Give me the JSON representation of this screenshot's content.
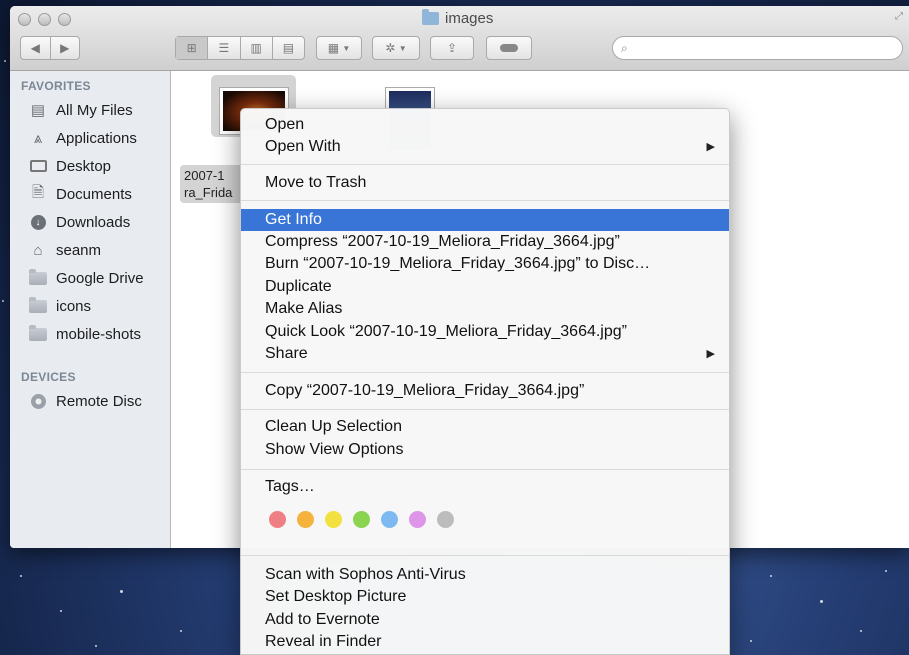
{
  "window": {
    "title": "images"
  },
  "search": {
    "placeholder": ""
  },
  "sidebar": {
    "favorites_header": "FAVORITES",
    "favorites": [
      {
        "label": "All My Files",
        "icon": "all-files-icon"
      },
      {
        "label": "Applications",
        "icon": "applications-icon"
      },
      {
        "label": "Desktop",
        "icon": "desktop-icon"
      },
      {
        "label": "Documents",
        "icon": "documents-icon"
      },
      {
        "label": "Downloads",
        "icon": "downloads-icon"
      },
      {
        "label": "seanm",
        "icon": "home-icon"
      },
      {
        "label": "Google Drive",
        "icon": "folder-icon"
      },
      {
        "label": "icons",
        "icon": "folder-icon"
      },
      {
        "label": "mobile-shots",
        "icon": "folder-icon"
      }
    ],
    "devices_header": "DEVICES",
    "devices": [
      {
        "label": "Remote Disc",
        "icon": "disc-icon"
      }
    ]
  },
  "files": {
    "selected_name_line1": "2007-1",
    "selected_name_line2": "ra_Frida"
  },
  "menu": {
    "open": "Open",
    "open_with": "Open With",
    "move_to_trash": "Move to Trash",
    "get_info": "Get Info",
    "compress": "Compress “2007-10-19_Meliora_Friday_3664.jpg”",
    "burn": "Burn “2007-10-19_Meliora_Friday_3664.jpg” to Disc…",
    "duplicate": "Duplicate",
    "make_alias": "Make Alias",
    "quick_look": "Quick Look “2007-10-19_Meliora_Friday_3664.jpg”",
    "share": "Share",
    "copy": "Copy “2007-10-19_Meliora_Friday_3664.jpg”",
    "clean_up": "Clean Up Selection",
    "show_view_options": "Show View Options",
    "tags": "Tags…",
    "scan_sophos": "Scan with Sophos Anti-Virus",
    "set_desktop": "Set Desktop Picture",
    "add_evernote": "Add to Evernote",
    "reveal_finder": "Reveal in Finder",
    "submenu_arrow": "▶"
  },
  "tag_colors": [
    "#f07f84",
    "#f5b33e",
    "#f3e13f",
    "#8ad451",
    "#7fb9f2",
    "#de95ea",
    "#bcbcbc"
  ],
  "highlight_color": "#3875d7"
}
